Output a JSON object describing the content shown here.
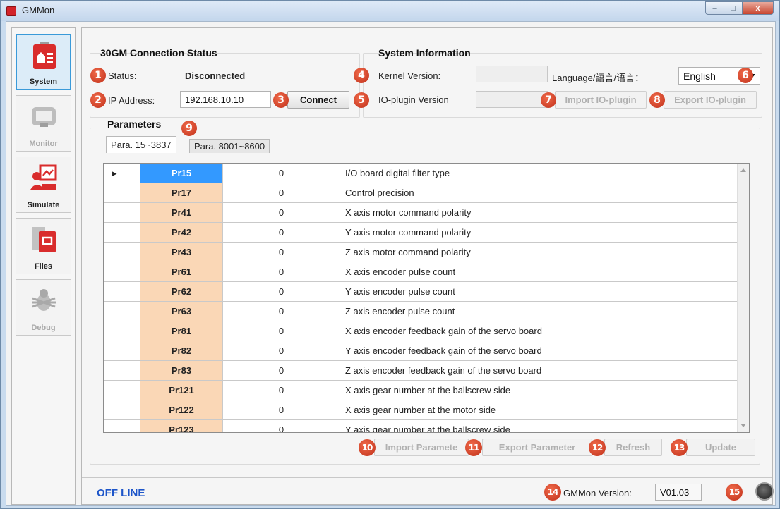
{
  "window": {
    "title": "GMMon",
    "controls": [
      "–",
      "□",
      "x"
    ]
  },
  "nav": {
    "items": [
      {
        "label": "System",
        "icon": "system-home-icon",
        "state": "selected"
      },
      {
        "label": "Monitor",
        "icon": "monitor-icon",
        "state": "disabled"
      },
      {
        "label": "Simulate",
        "icon": "simulate-icon",
        "state": "normal"
      },
      {
        "label": "Files",
        "icon": "files-icon",
        "state": "normal"
      },
      {
        "label": "Debug",
        "icon": "debug-bug-icon",
        "state": "disabled"
      }
    ]
  },
  "connection": {
    "title": "30GM Connection Status",
    "status_label": "Status:",
    "status_value": "Disconnected",
    "ip_label": "IP Address:",
    "ip_value": "192.168.10.10",
    "connect_label": "Connect"
  },
  "system": {
    "title": "System Information",
    "kernel_label": "Kernel Version:",
    "kernel_value": "",
    "ioplugin_label": "IO-plugin Version",
    "ioplugin_value": "",
    "language_label": "Language/語言/语言：",
    "language_value": "English",
    "import_io_label": "Import IO-plugin",
    "export_io_label": "Export IO-plugin"
  },
  "parameters": {
    "title": "Parameters",
    "tabs": [
      "Para. 15~3837",
      "Para. 8001~8600"
    ],
    "rows": [
      {
        "name": "Pr15",
        "value": "0",
        "desc": "I/O board digital filter type"
      },
      {
        "name": "Pr17",
        "value": "0",
        "desc": "Control precision"
      },
      {
        "name": "Pr41",
        "value": "0",
        "desc": "X axis motor command polarity"
      },
      {
        "name": "Pr42",
        "value": "0",
        "desc": "Y axis motor command polarity"
      },
      {
        "name": "Pr43",
        "value": "0",
        "desc": "Z axis motor command polarity"
      },
      {
        "name": "Pr61",
        "value": "0",
        "desc": "X axis encoder pulse count"
      },
      {
        "name": "Pr62",
        "value": "0",
        "desc": "Y axis encoder pulse count"
      },
      {
        "name": "Pr63",
        "value": "0",
        "desc": "Z axis encoder pulse count"
      },
      {
        "name": "Pr81",
        "value": "0",
        "desc": "X axis encoder feedback gain of the servo board"
      },
      {
        "name": "Pr82",
        "value": "0",
        "desc": "Y axis encoder feedback gain of the servo board"
      },
      {
        "name": "Pr83",
        "value": "0",
        "desc": "Z axis encoder feedback gain of the servo board"
      },
      {
        "name": "Pr121",
        "value": "0",
        "desc": "X axis gear number at the ballscrew side"
      },
      {
        "name": "Pr122",
        "value": "0",
        "desc": "X axis gear number at the motor side"
      },
      {
        "name": "Pr123",
        "value": "0",
        "desc": "Y axis gear number at the ballscrew side"
      }
    ],
    "selected_row_marker": "▸",
    "import_label": "Import Paramete",
    "export_label": "Export Parameter",
    "refresh_label": "Refresh",
    "update_label": "Update"
  },
  "footer": {
    "offline_text": "OFF LINE",
    "version_label": "GMMon Version:",
    "version_value": "V01.03"
  },
  "callouts": [
    "1",
    "2",
    "3",
    "4",
    "5",
    "6",
    "7",
    "8",
    "9",
    "10",
    "11",
    "12",
    "13",
    "14",
    "15"
  ],
  "colors": {
    "callout": "#d9432a",
    "selected_cell": "#3399ff",
    "param_name_bg": "#fad7b6",
    "offline_text": "#1d55c9"
  }
}
